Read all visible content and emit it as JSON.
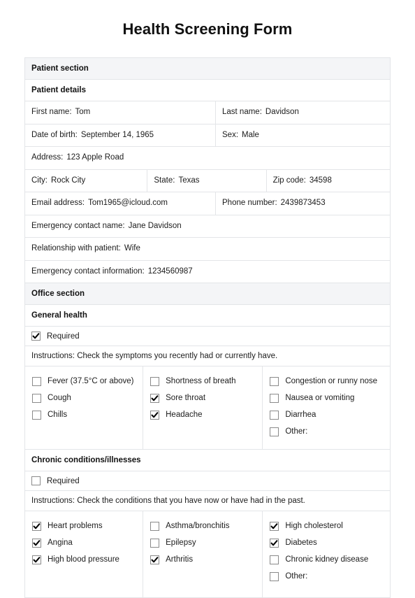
{
  "document": {
    "title": "Health Screening Form"
  },
  "patient_section": {
    "header": "Patient section",
    "subheader": "Patient details",
    "fields": {
      "first_name_label": "First name:",
      "first_name_value": "Tom",
      "last_name_label": "Last name:",
      "last_name_value": "Davidson",
      "dob_label": "Date of birth:",
      "dob_value": "September 14, 1965",
      "sex_label": "Sex:",
      "sex_value": "Male",
      "address_label": "Address:",
      "address_value": "123 Apple Road",
      "city_label": "City:",
      "city_value": "Rock City",
      "state_label": "State:",
      "state_value": "Texas",
      "zip_label": "Zip code:",
      "zip_value": "34598",
      "email_label": "Email address:",
      "email_value": "Tom1965@icloud.com",
      "phone_label": "Phone number:",
      "phone_value": "2439873453",
      "emergency_name_label": "Emergency contact name:",
      "emergency_name_value": "Jane Davidson",
      "relationship_label": "Relationship with patient:",
      "relationship_value": "Wife",
      "emergency_info_label": "Emergency contact information:",
      "emergency_info_value": "1234560987"
    }
  },
  "office_section": {
    "header": "Office section",
    "general_health": {
      "subheader": "General health",
      "required_label": "Required",
      "required_checked": true,
      "instructions": "Instructions: Check the symptoms you recently had or currently have.",
      "columns": [
        {
          "items": [
            {
              "label": "Fever (37.5°C or above)",
              "checked": false
            },
            {
              "label": "Cough",
              "checked": false
            },
            {
              "label": "Chills",
              "checked": false
            }
          ]
        },
        {
          "items": [
            {
              "label": "Shortness of breath",
              "checked": false
            },
            {
              "label": "Sore throat",
              "checked": true
            },
            {
              "label": "Headache",
              "checked": true
            }
          ]
        },
        {
          "items": [
            {
              "label": "Congestion or runny nose",
              "checked": false
            },
            {
              "label": "Nausea or vomiting",
              "checked": false
            },
            {
              "label": "Diarrhea",
              "checked": false
            },
            {
              "label": "Other:",
              "checked": false
            }
          ]
        }
      ]
    },
    "chronic_conditions": {
      "subheader": "Chronic conditions/illnesses",
      "required_label": "Required",
      "required_checked": false,
      "instructions": "Instructions: Check the conditions that you have now or have had in the past.",
      "columns": [
        {
          "items": [
            {
              "label": "Heart problems",
              "checked": true
            },
            {
              "label": "Angina",
              "checked": true
            },
            {
              "label": "High blood pressure",
              "checked": true
            }
          ]
        },
        {
          "items": [
            {
              "label": "Asthma/bronchitis",
              "checked": false
            },
            {
              "label": "Epilepsy",
              "checked": false
            },
            {
              "label": "Arthritis",
              "checked": true
            }
          ]
        },
        {
          "items": [
            {
              "label": "High cholesterol",
              "checked": true
            },
            {
              "label": "Diabetes",
              "checked": true
            },
            {
              "label": "Chronic kidney disease",
              "checked": false
            },
            {
              "label": "Other:",
              "checked": false
            }
          ]
        }
      ]
    }
  },
  "colors": {
    "border": "#e3e5e8",
    "section_header_bg": "#f4f5f7",
    "text": "#1c1c1c",
    "checkbox_border": "#8a8a8a"
  }
}
